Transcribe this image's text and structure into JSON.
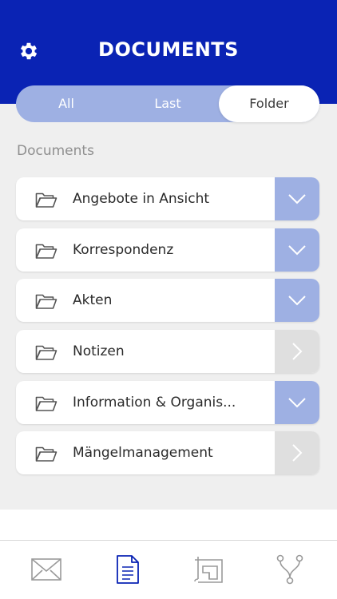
{
  "header": {
    "title": "DOCUMENTS",
    "settings_icon": "gear-icon",
    "background_color": "#0a23b4"
  },
  "segmented": {
    "options": [
      "All",
      "Last",
      "Folder"
    ],
    "selected": "Folder",
    "active_color": "#ffffff",
    "inactive_color": "#9eb0e3"
  },
  "section": {
    "label": "Documents"
  },
  "folders": [
    {
      "label": "Angebote in Ansicht",
      "action": "expand"
    },
    {
      "label": "Korrespondenz",
      "action": "expand"
    },
    {
      "label": "Akten",
      "action": "expand"
    },
    {
      "label": "Notizen",
      "action": "open"
    },
    {
      "label": "Information & Organis...",
      "action": "expand"
    },
    {
      "label": "Mängelmanagement",
      "action": "open"
    }
  ],
  "bottom_nav": {
    "items": [
      {
        "icon": "mail-icon",
        "active": false
      },
      {
        "icon": "document-icon",
        "active": true
      },
      {
        "icon": "floorplan-icon",
        "active": false
      },
      {
        "icon": "workflow-icon",
        "active": false
      }
    ],
    "active_color": "#0a23b4",
    "inactive_color": "#9a9a9a"
  }
}
